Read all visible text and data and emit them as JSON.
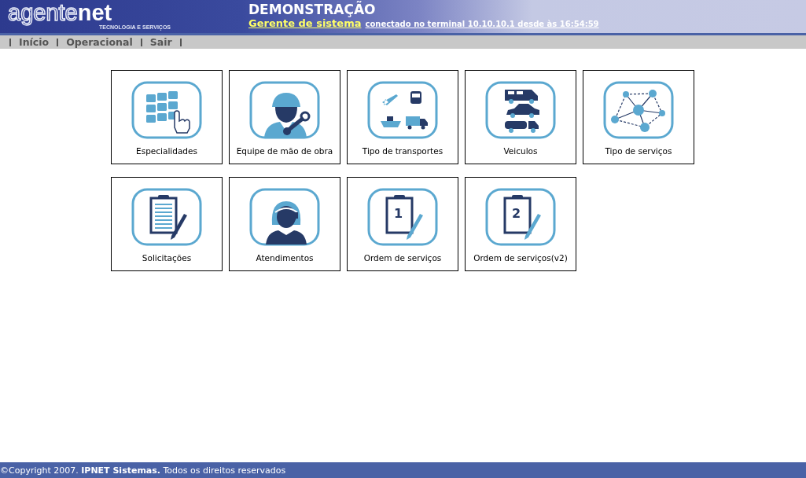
{
  "header": {
    "logo": {
      "main": "agente",
      "accent": "net",
      "tagline": "TECNOLOGIA E SERVIÇOS"
    },
    "title": "DEMONSTRAÇÃO",
    "user": "Gerente de sistema",
    "session": "conectado no terminal 10.10.10.1 desde às 16:54:59"
  },
  "nav": {
    "items": [
      "Início",
      "Operacional",
      "Sair"
    ]
  },
  "tiles": [
    {
      "label": "Especialidades",
      "kind": "keypad"
    },
    {
      "label": "Equipe de mão de obra",
      "kind": "worker"
    },
    {
      "label": "Tipo de transportes",
      "kind": "transport"
    },
    {
      "label": "Veiculos",
      "kind": "vehicles"
    },
    {
      "label": "Tipo de serviços",
      "kind": "network"
    },
    {
      "label": "Solicitações",
      "kind": "clipboard"
    },
    {
      "label": "Atendimentos",
      "kind": "agent"
    },
    {
      "label": "Ordem de serviços",
      "kind": "numbered",
      "number": "1"
    },
    {
      "label": "Ordem de serviços(v2)",
      "kind": "numbered",
      "number": "2"
    }
  ],
  "footer": {
    "text": "©Copyright 2007. **IPNET Sistemas.** Todos os direitos reservados"
  }
}
